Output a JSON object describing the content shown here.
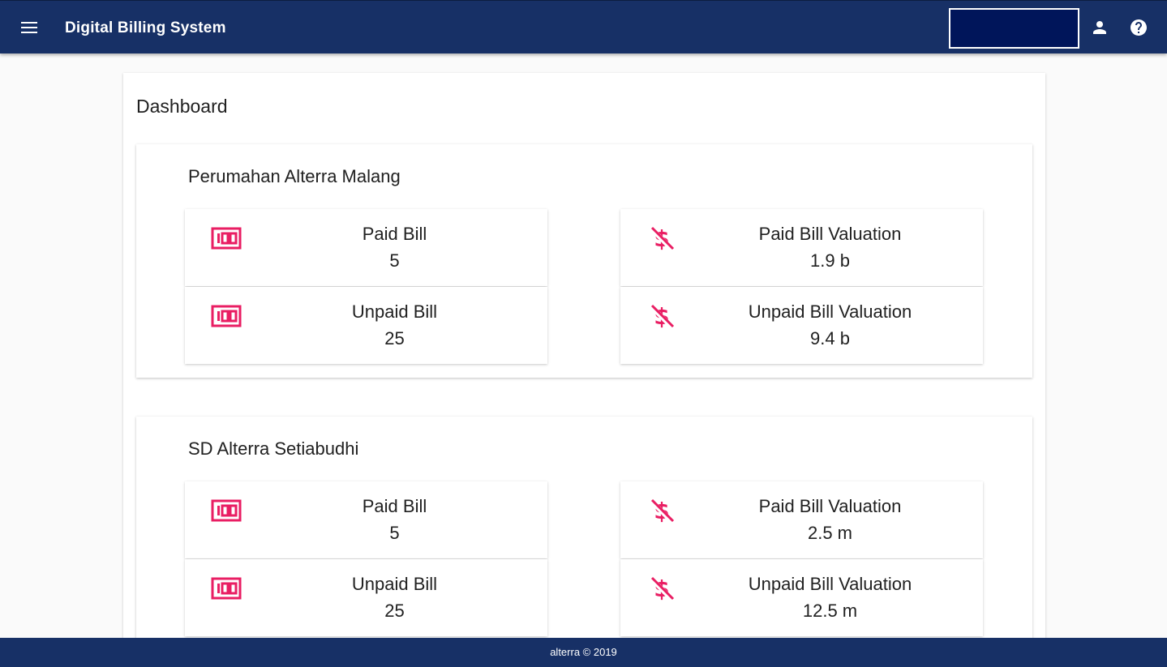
{
  "header": {
    "title": "Digital Billing System",
    "menu_icon": "menu-icon",
    "account_icon": "account-icon",
    "help_icon": "help-icon",
    "search": {
      "value": "",
      "placeholder": ""
    }
  },
  "page": {
    "title": "Dashboard"
  },
  "colors": {
    "appbar": "#173066",
    "accent": "#e91e63",
    "search_bg": "#00155a"
  },
  "locations": [
    {
      "name": "Perumahan Alterra Malang",
      "paid_bill": {
        "label": "Paid Bill",
        "value": "5",
        "icon": "money-icon"
      },
      "unpaid_bill": {
        "label": "Unpaid Bill",
        "value": "25",
        "icon": "money-icon"
      },
      "paid_valuation": {
        "label": "Paid Bill Valuation",
        "value": "1.9 b",
        "icon": "money-off-icon"
      },
      "unpaid_valuation": {
        "label": "Unpaid Bill Valuation",
        "value": "9.4 b",
        "icon": "money-off-icon"
      }
    },
    {
      "name": "SD Alterra Setiabudhi",
      "paid_bill": {
        "label": "Paid Bill",
        "value": "5",
        "icon": "money-icon"
      },
      "unpaid_bill": {
        "label": "Unpaid Bill",
        "value": "25",
        "icon": "money-icon"
      },
      "paid_valuation": {
        "label": "Paid Bill Valuation",
        "value": "2.5 m",
        "icon": "money-off-icon"
      },
      "unpaid_valuation": {
        "label": "Unpaid Bill Valuation",
        "value": "12.5 m",
        "icon": "money-off-icon"
      }
    }
  ],
  "footer": {
    "text": "alterra  © 2019"
  }
}
